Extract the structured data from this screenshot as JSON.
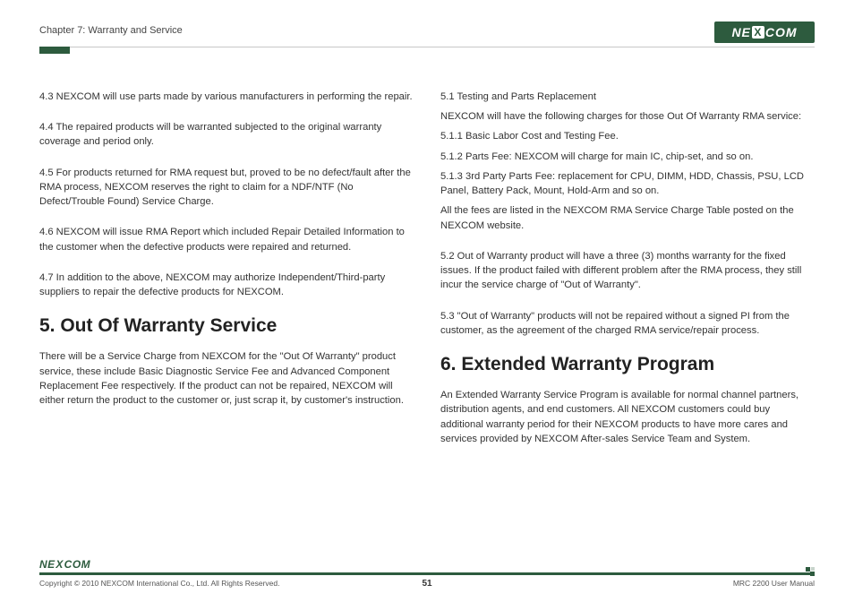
{
  "header": {
    "chapter": "Chapter 7: Warranty and Service",
    "logo_text_left": "NE",
    "logo_text_x": "X",
    "logo_text_right": "COM"
  },
  "left_col": {
    "p43": "4.3 NEXCOM will use parts made by various manufacturers in performing the repair.",
    "p44": "4.4 The repaired products will be warranted subjected to the original warranty coverage and period only.",
    "p45": "4.5 For products returned for RMA request but, proved to be no defect/fault after the RMA process, NEXCOM reserves the right to claim for a NDF/NTF (No Defect/Trouble Found) Service Charge.",
    "p46": "4.6 NEXCOM will issue RMA Report which included Repair Detailed Information to the customer when the defective products were repaired and returned.",
    "p47": "4.7 In addition to the above, NEXCOM may authorize Independent/Third-party suppliers to repair the defective products for NEXCOM.",
    "h5": "5. Out Of Warranty Service",
    "p5intro": "There will be a Service Charge from NEXCOM for the \"Out Of Warranty\" product service, these include Basic Diagnostic Service Fee and Advanced Component Replacement Fee respectively. If the product can not be repaired, NEXCOM will either return the product to the customer or, just scrap it, by customer's instruction."
  },
  "right_col": {
    "p51h": "5.1 Testing and Parts Replacement",
    "p51intro": "NEXCOM will have the following charges for those Out Of Warranty RMA service:",
    "p511": "5.1.1 Basic Labor Cost and Testing Fee.",
    "p512": "5.1.2 Parts Fee: NEXCOM will charge for main IC, chip-set, and so on.",
    "p513": "5.1.3 3rd Party Parts Fee: replacement for CPU, DIMM, HDD, Chassis, PSU, LCD Panel, Battery Pack, Mount, Hold-Arm and so on.",
    "p51note": "All the fees are listed in the NEXCOM RMA Service Charge Table posted on the NEXCOM website.",
    "p52": "5.2 Out of Warranty product will have a three (3) months warranty for the fixed issues. If the product failed with different problem after the RMA process, they still incur the service charge of \"Out of Warranty\".",
    "p53": "5.3 \"Out of Warranty\" products will not be repaired without a signed PI from the customer, as the agreement of the charged RMA service/repair process.",
    "h6": "6. Extended Warranty Program",
    "p6intro": "An Extended Warranty Service Program is available for normal channel partners, distribution agents, and end customers. All NEXCOM customers could buy additional warranty period for their NEXCOM products to have more cares and services provided by NEXCOM After-sales Service Team and System."
  },
  "footer": {
    "copyright": "Copyright © 2010 NEXCOM International Co., Ltd. All Rights Reserved.",
    "page": "51",
    "manual": "MRC 2200 User Manual",
    "logo_text_left": "NE",
    "logo_text_x": "X",
    "logo_text_right": "COM"
  }
}
